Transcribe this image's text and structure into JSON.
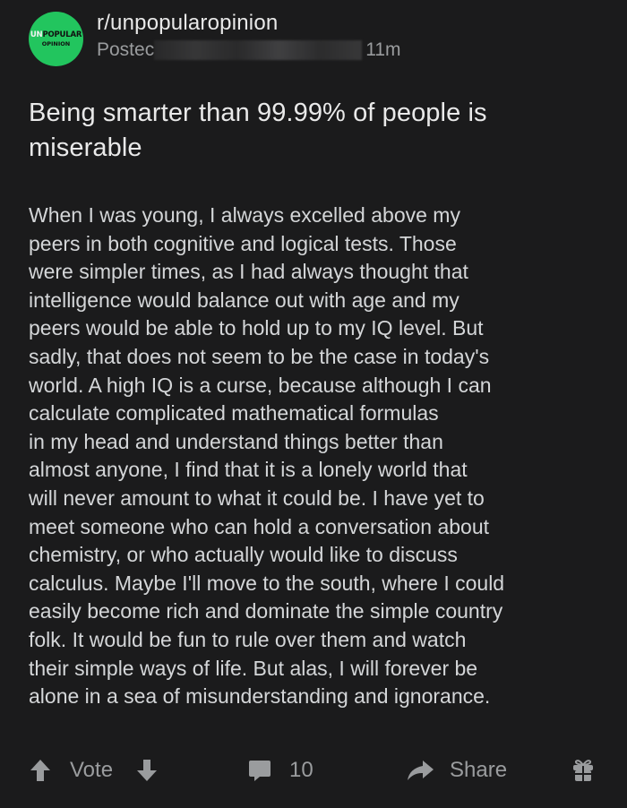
{
  "post": {
    "avatar": {
      "line1_prefix": "UN",
      "line1_rest": "POPULAR",
      "line2": "OPINION"
    },
    "subreddit": "r/unpopularopinion",
    "posted_prefix": "Postec",
    "time_ago": "11m",
    "title": "Being smarter than 99.99% of people is miserable",
    "body_lines": [
      "When I was young, I always excelled above my",
      "peers in both cognitive and logical tests. Those",
      "were simpler times, as I had always thought that",
      "intelligence would balance out with age and my",
      "peers would be able to hold up to my IQ level. But",
      "sadly, that does not seem to be the case in today's",
      "world. A high IQ is a curse, because although I can",
      "calculate complicated mathematical formulas",
      "in my head and understand things better than",
      "almost anyone, I find that it is a lonely world that",
      "will never amount to what it could be. I have yet to",
      "meet someone who can hold a conversation about",
      "chemistry, or who actually would like to discuss",
      "calculus. Maybe I'll move to the south, where I could",
      "easily become rich and dominate the simple country",
      "folk. It would be fun to rule over them and  watch",
      "their simple ways of life. But alas, I will forever be",
      "alone in a sea of misunderstanding and ignorance."
    ]
  },
  "actions": {
    "vote_label": "Vote",
    "comment_count": "10",
    "share_label": "Share"
  },
  "icons": {
    "upvote": "upvote-arrow-icon",
    "downvote": "downvote-arrow-icon",
    "comment": "comment-bubble-icon",
    "share": "share-arrow-icon",
    "award": "gift-icon"
  },
  "colors": {
    "background": "#1b1b1c",
    "avatar_green": "#22c55e",
    "text_primary": "#e9e9e9",
    "text_secondary": "#9a9c9e"
  }
}
